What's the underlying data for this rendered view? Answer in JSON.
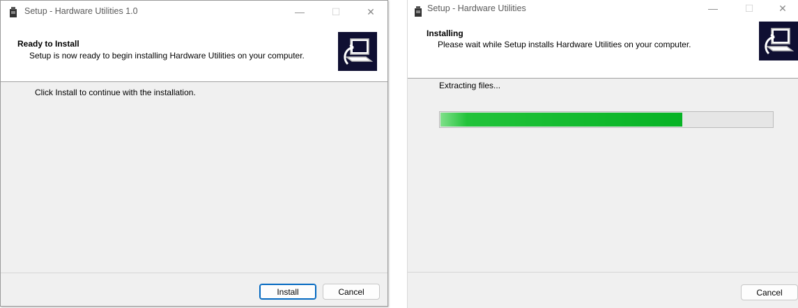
{
  "left_window": {
    "title": "Setup - Hardware Utilities 1.0",
    "header_title": "Ready to Install",
    "header_subtitle": "Setup is now ready to begin installing Hardware Utilities on your computer.",
    "instruction": "Click Install to continue with the installation.",
    "install_label": "Install",
    "cancel_label": "Cancel"
  },
  "right_window": {
    "title": "Setup - Hardware Utilities",
    "header_title": "Installing",
    "header_subtitle": "Please wait while Setup installs Hardware Utilities on your computer.",
    "status": "Extracting files...",
    "progress_fraction": 0.73,
    "cancel_label": "Cancel"
  },
  "window_controls": {
    "minimize": "—",
    "maximize": "☐",
    "close": "✕"
  },
  "icons": {
    "app": "setup-app-icon",
    "logo": "computer-install-icon"
  },
  "colors": {
    "progress_fill": "#07b325",
    "progress_track": "#e6e6e6",
    "logo_background": "#0f0f32",
    "default_button_border": "#0067c0"
  }
}
